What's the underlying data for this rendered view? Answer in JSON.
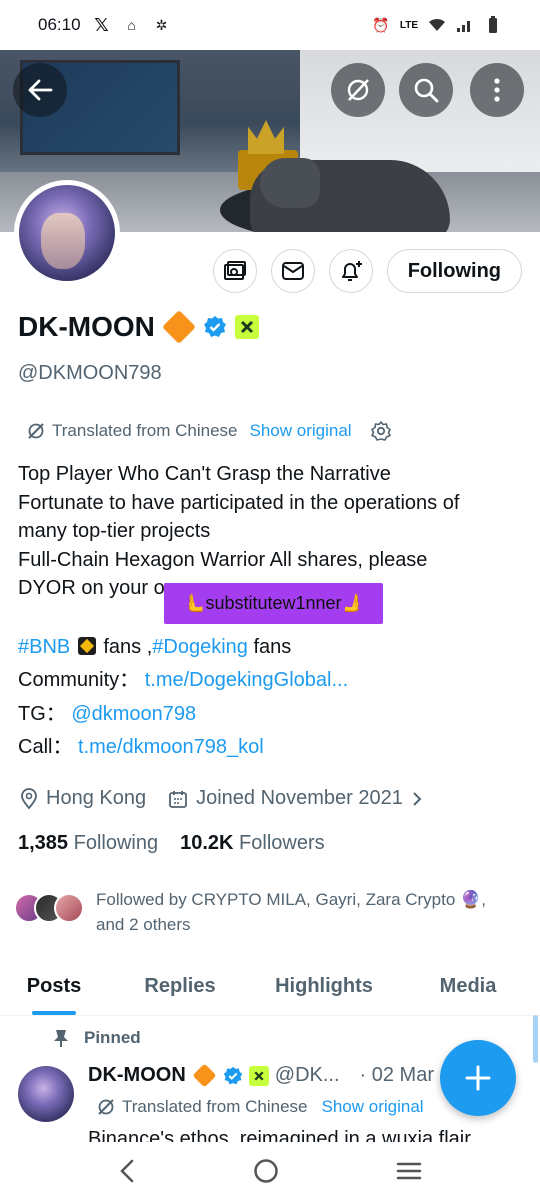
{
  "status_bar": {
    "time": "06:10",
    "right_text": "LTE"
  },
  "banner": {
    "back": "back",
    "actions": [
      "grok",
      "search",
      "more"
    ]
  },
  "profile": {
    "name": "DK-MOON",
    "handle": "@DKMOON798",
    "follow_button": "Following",
    "translation": {
      "label": "Translated from Chinese",
      "show_original": "Show original"
    },
    "bio_lines": [
      "Top Player Who Can't Grasp the Narrative",
      "Fortunate to have participated in the operations of",
      "many top-tier projects",
      "Full-Chain Hexagon Warrior   All shares, please",
      "DYOR on your own"
    ],
    "sticker": "🫷substitutew1nner🫸",
    "tags_line": {
      "tag1": "#BNB",
      "fans1": " fans ,",
      "tag2": "#Dogeking",
      "fans2": " fans"
    },
    "community": {
      "label": "Community：",
      "link": "t.me/DogekingGlobal..."
    },
    "tg": {
      "label": "TG：",
      "link": "@dkmoon798"
    },
    "call": {
      "label": "Call：",
      "link": "t.me/dkmoon798_kol"
    },
    "location": "Hong Kong",
    "joined": "Joined November 2021",
    "following_count": "1,385",
    "following_label": "Following",
    "followers_count": "10.2K",
    "followers_label": "Followers",
    "followed_by_line1": "Followed by CRYPTO MILA, Gayri, Zara Crypto 🔮,",
    "followed_by_line2": "and 2 others"
  },
  "tabs": [
    "Posts",
    "Replies",
    "Highlights",
    "Media"
  ],
  "pinned_post": {
    "pinned_label": "Pinned",
    "name": "DK-MOON",
    "handle": "@DK...",
    "date": "· 02 Mar",
    "translated": "Translated from Chinese",
    "show_original": "Show original",
    "text": "Binance's ethos, reimagined in a wuxia flair"
  },
  "colors": {
    "accent": "#1d9bf0",
    "text": "#0f1419",
    "muted": "#536471",
    "sticker_bg": "#a43df0"
  }
}
